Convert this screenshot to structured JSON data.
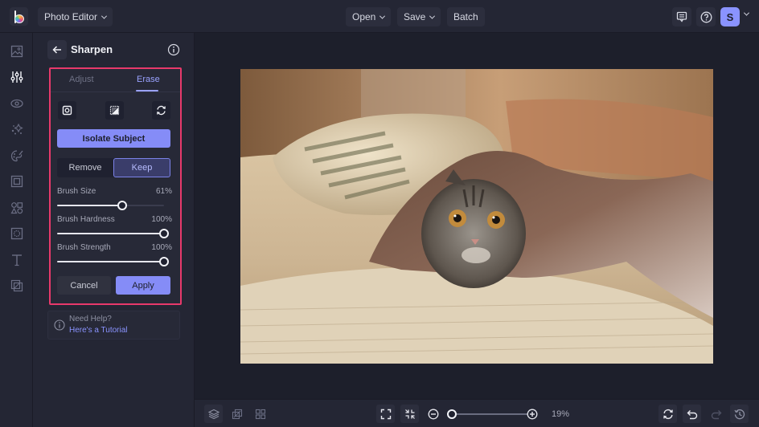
{
  "topbar": {
    "app_menu_label": "Photo Editor",
    "open_label": "Open",
    "save_label": "Save",
    "batch_label": "Batch",
    "avatar_initial": "S"
  },
  "rail": {
    "items": [
      {
        "name": "image",
        "icon": "image-icon",
        "active": false
      },
      {
        "name": "adjustments",
        "icon": "sliders-icon",
        "active": true
      },
      {
        "name": "effects",
        "icon": "eye-icon",
        "active": false
      },
      {
        "name": "touch-up",
        "icon": "sparkles-icon",
        "active": false
      },
      {
        "name": "artsy",
        "icon": "palette-icon",
        "active": false
      },
      {
        "name": "frames",
        "icon": "frame-icon",
        "active": false
      },
      {
        "name": "graphics",
        "icon": "shapes-icon",
        "active": false
      },
      {
        "name": "textures",
        "icon": "texture-icon",
        "active": false
      },
      {
        "name": "text",
        "icon": "text-icon",
        "active": false
      },
      {
        "name": "overlays",
        "icon": "overlay-icon",
        "active": false
      }
    ]
  },
  "panel": {
    "title": "Sharpen",
    "tabs": [
      {
        "label": "Adjust",
        "active": false
      },
      {
        "label": "Erase",
        "active": true
      }
    ],
    "tool_icons": [
      "brush-mask-icon",
      "invert-selection-icon",
      "reset-icon"
    ],
    "isolate_label": "Isolate Subject",
    "segment": [
      {
        "label": "Remove",
        "active": false
      },
      {
        "label": "Keep",
        "active": true
      }
    ],
    "sliders": [
      {
        "label": "Brush Size",
        "value_text": "61%",
        "value": 0.61
      },
      {
        "label": "Brush Hardness",
        "value_text": "100%",
        "value": 1.0
      },
      {
        "label": "Brush Strength",
        "value_text": "100%",
        "value": 1.0
      }
    ],
    "cancel_label": "Cancel",
    "apply_label": "Apply",
    "help_title": "Need Help?",
    "help_link": "Here's a Tutorial"
  },
  "canvas": {
    "image_description": "Tabby Scottish Fold cat peeking out from under a shaggy brown blanket on a beige couch"
  },
  "bottombar": {
    "zoom_text": "19%",
    "zoom_value": 0.0
  },
  "colors": {
    "accent": "#858cf7",
    "highlight_border": "#e8396b",
    "background": "#1d1f2b",
    "panel": "#242634"
  }
}
